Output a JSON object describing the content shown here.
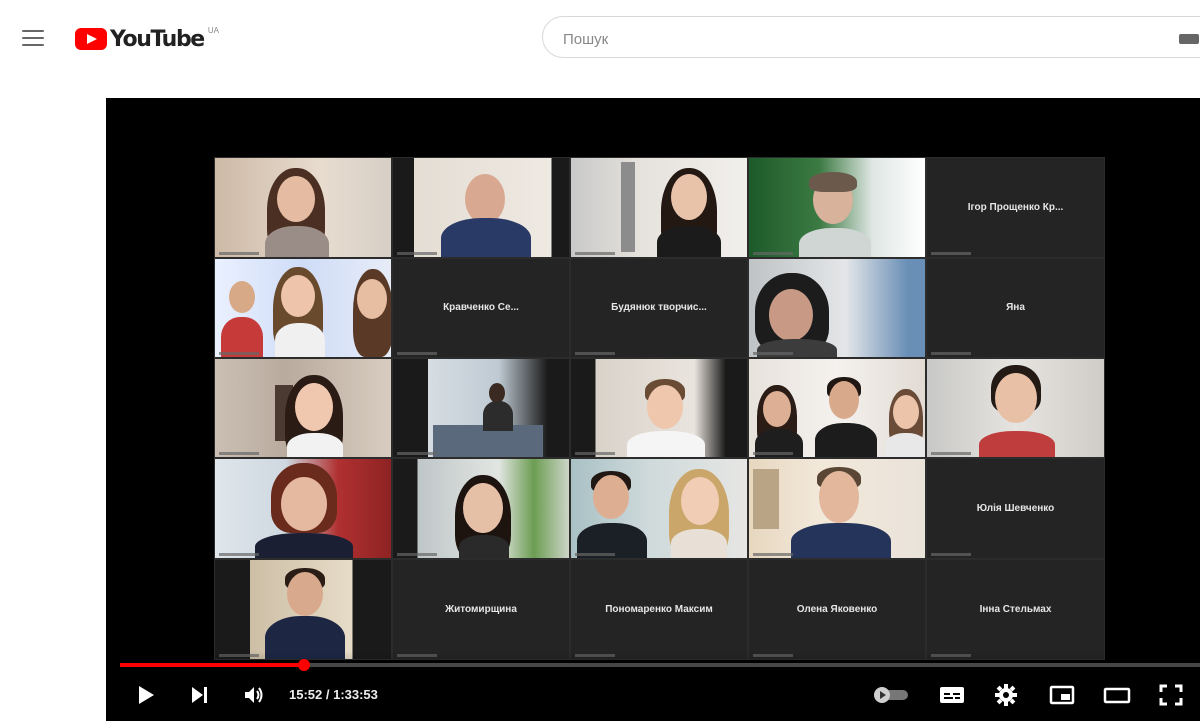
{
  "masthead": {
    "logo_text": "YouTube",
    "logo_region": "UA",
    "search_placeholder": "Пошук"
  },
  "player": {
    "current_time": "15:52",
    "duration": "1:33:53",
    "time_display": "15:52 / 1:33:53",
    "progress_fraction": 0.17,
    "participants_names": {
      "t05": "Ігор Прощенко Кр...",
      "t07": "Кравченко Се...",
      "t08": "Будянюк творчис...",
      "t10": "Яна",
      "t20": "Юлія Шевченко",
      "t22": "Житомирщина",
      "t23": "Пономаренко Максим",
      "t24": "Олена Яковенко",
      "t25": "Інна Стельмах"
    }
  },
  "colors": {
    "accent": "#ff0000",
    "player_bg": "#000000",
    "tile_bg": "#242424"
  },
  "icons": {
    "menu": "hamburger-icon",
    "play": "play-icon",
    "next": "next-icon",
    "volume": "volume-icon",
    "autoplay": "autoplay-toggle-icon",
    "subtitles": "subtitles-icon",
    "settings": "gear-icon",
    "miniplayer": "miniplayer-icon",
    "theater": "theater-mode-icon",
    "fullscreen": "fullscreen-icon"
  }
}
